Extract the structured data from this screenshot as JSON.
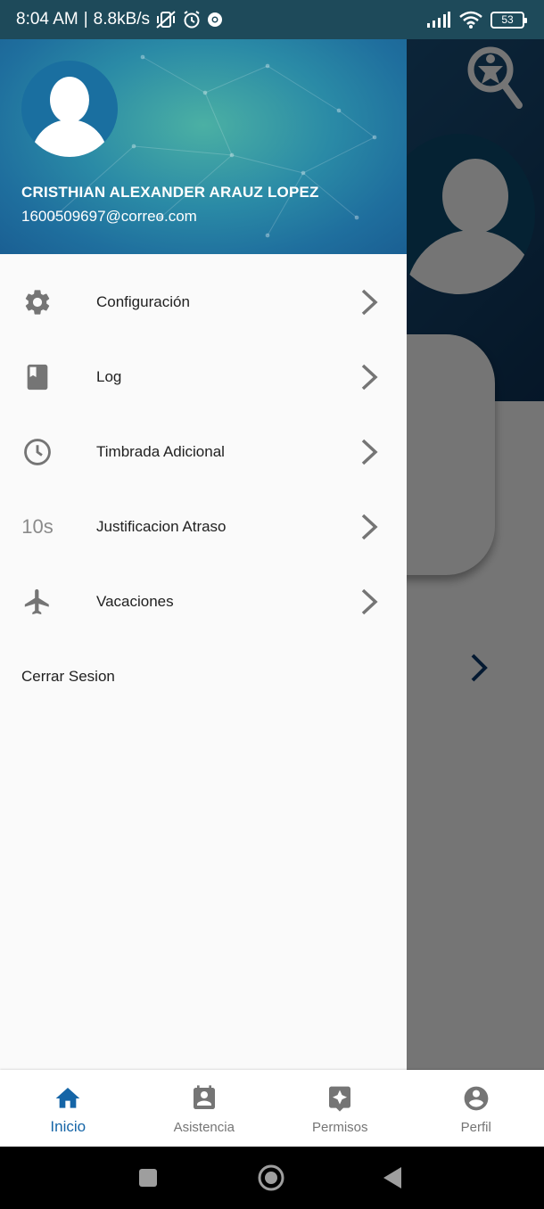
{
  "status_bar": {
    "time": "8:04 AM",
    "network_speed": "8.8kB/s",
    "battery_level": "53",
    "icons": [
      "muted-vibrate-icon",
      "alarm-icon",
      "chrome-icon",
      "signal-icon",
      "wifi-icon",
      "battery-icon"
    ]
  },
  "drawer": {
    "user_name": "CRISTHIAN ALEXANDER ARAUZ LOPEZ",
    "user_email": "1600509697@correo.com",
    "items": [
      {
        "label": "Configuración",
        "icon": "gear-icon"
      },
      {
        "label": "Log",
        "icon": "book-icon"
      },
      {
        "label": "Timbrada Adicional",
        "icon": "clock-icon"
      },
      {
        "label": "Justificacion Atraso",
        "icon": "ten-seconds-icon",
        "icon_text": "10s"
      },
      {
        "label": "Vacaciones",
        "icon": "airplane-icon"
      }
    ],
    "logout_label": "Cerrar Sesion"
  },
  "bottom_nav": {
    "items": [
      {
        "label": "Inicio",
        "icon": "home-icon",
        "active": true
      },
      {
        "label": "Asistencia",
        "icon": "contact-calendar-icon",
        "active": false
      },
      {
        "label": "Permisos",
        "icon": "sparkle-tag-icon",
        "active": false
      },
      {
        "label": "Perfil",
        "icon": "account-circle-icon",
        "active": false
      }
    ]
  },
  "colors": {
    "accent": "#1565a7",
    "icon_gray": "#757575",
    "drawer_bg": "#fafafa",
    "status_bar": "#1e4a5a"
  }
}
